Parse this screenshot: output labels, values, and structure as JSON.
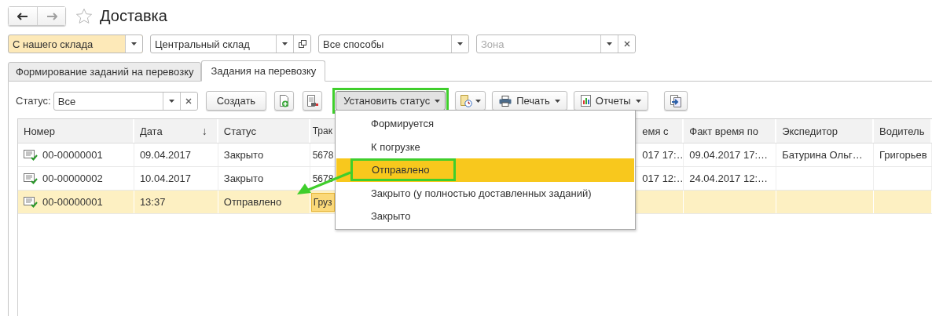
{
  "nav": {
    "title": "Доставка",
    "favorite": false,
    "back_enabled": true,
    "forward_enabled": false
  },
  "filters": [
    {
      "value": "С нашего склада",
      "highlighted": true,
      "open_button": false,
      "clearable": false
    },
    {
      "value": "Центральный склад",
      "highlighted": false,
      "open_button": true,
      "clearable": false
    },
    {
      "value": "Все способы",
      "highlighted": false,
      "open_button": false,
      "clearable": false
    },
    {
      "placeholder": "Зона",
      "highlighted": false,
      "open_button": false,
      "clearable": true
    }
  ],
  "tabs": [
    {
      "label": "Формирование заданий на перевозку",
      "selected": false
    },
    {
      "label": "Задания на перевозку",
      "selected": true
    }
  ],
  "toolbar": {
    "status_label": "Статус:",
    "status_value": "Все",
    "create_button": "Создать",
    "set_status_button": {
      "label": "Установить статус",
      "pressed": true
    },
    "print_button": "Печать",
    "reports_button": "Отчеты"
  },
  "status_menu": {
    "open": true,
    "items": [
      {
        "label": "Формируется",
        "selected": false
      },
      {
        "label": "К погрузке",
        "selected": false
      },
      {
        "label": "Отправлено",
        "selected": true
      },
      {
        "label": "Закрыто (у полностью доставленных заданий)",
        "selected": false
      },
      {
        "label": "Закрыто",
        "selected": false
      }
    ]
  },
  "table": {
    "columns": [
      {
        "label": "Номер"
      },
      {
        "label": "Дата",
        "sort_mark": "↓"
      },
      {
        "label": "Статус"
      },
      {
        "label": "Трак"
      },
      {
        "label": "емя с"
      },
      {
        "label": "Факт время по"
      },
      {
        "label": "Экспедитор"
      },
      {
        "label": "Водитель"
      }
    ],
    "rows": [
      {
        "selected": false,
        "cells": [
          "00-00000001",
          "09.04.2017",
          "Закрыто",
          "5678",
          "017 17:…",
          "09.04.2017 17:…",
          "Батурина Ольг…",
          "Григорьев"
        ]
      },
      {
        "selected": false,
        "cells": [
          "00-00000002",
          "10.04.2017",
          "Закрыто",
          "5678",
          "017 12:…",
          "24.04.2017 12:…",
          null,
          null
        ]
      },
      {
        "selected": true,
        "cells": [
          "00-00000001",
          "13:37",
          "Отправлено",
          {
            "text": "Груз",
            "focused": true
          },
          null,
          null,
          null,
          null
        ]
      }
    ]
  }
}
